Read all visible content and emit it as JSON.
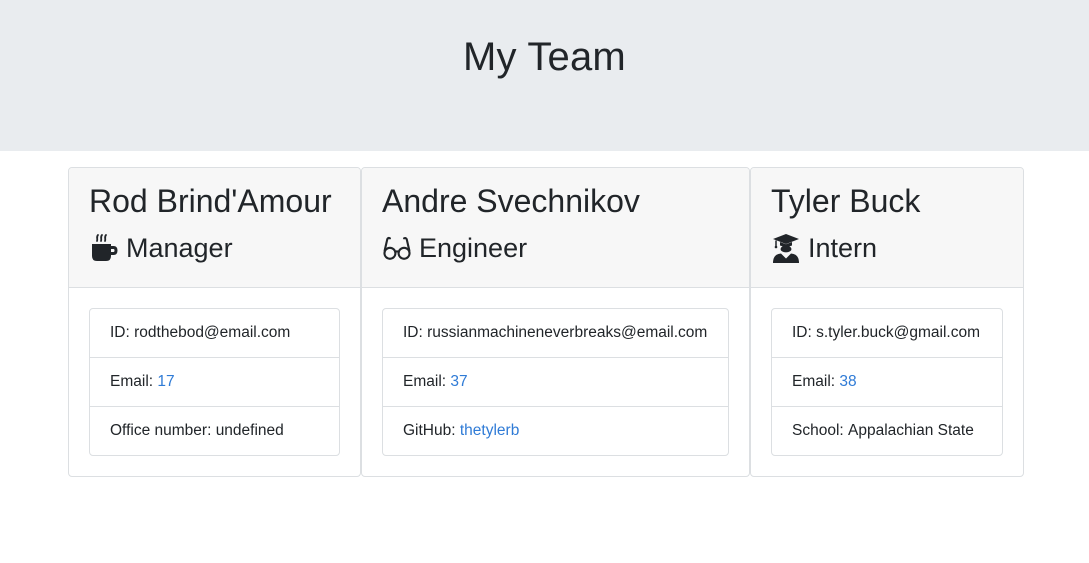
{
  "header": {
    "title": "My Team"
  },
  "team": [
    {
      "name": "Rod Brind'Amour",
      "role": "Manager",
      "role_icon": "coffee-mug-icon",
      "id_label": "ID: ",
      "id_value": "rodthebod@email.com",
      "email_label": "Email: ",
      "email_value": "17",
      "extra_label": "Office number: ",
      "extra_value": "undefined"
    },
    {
      "name": "Andre Svechnikov",
      "role": "Engineer",
      "role_icon": "glasses-icon",
      "id_label": "ID: ",
      "id_value": "russianmachineneverbreaks@email.com",
      "email_label": "Email: ",
      "email_value": "37",
      "extra_label": "GitHub: ",
      "extra_value": "thetylerb"
    },
    {
      "name": "Tyler Buck",
      "role": "Intern",
      "role_icon": "graduate-icon",
      "id_label": "ID: ",
      "id_value": "s.tyler.buck@gmail.com",
      "email_label": "Email: ",
      "email_value": "38",
      "extra_label": "School: ",
      "extra_value": "Appalachian State"
    }
  ],
  "colors": {
    "jumbotron_bg": "#e9ecef",
    "card_header_bg": "#f7f7f7",
    "link": "#2f7bd6",
    "text": "#212529"
  }
}
